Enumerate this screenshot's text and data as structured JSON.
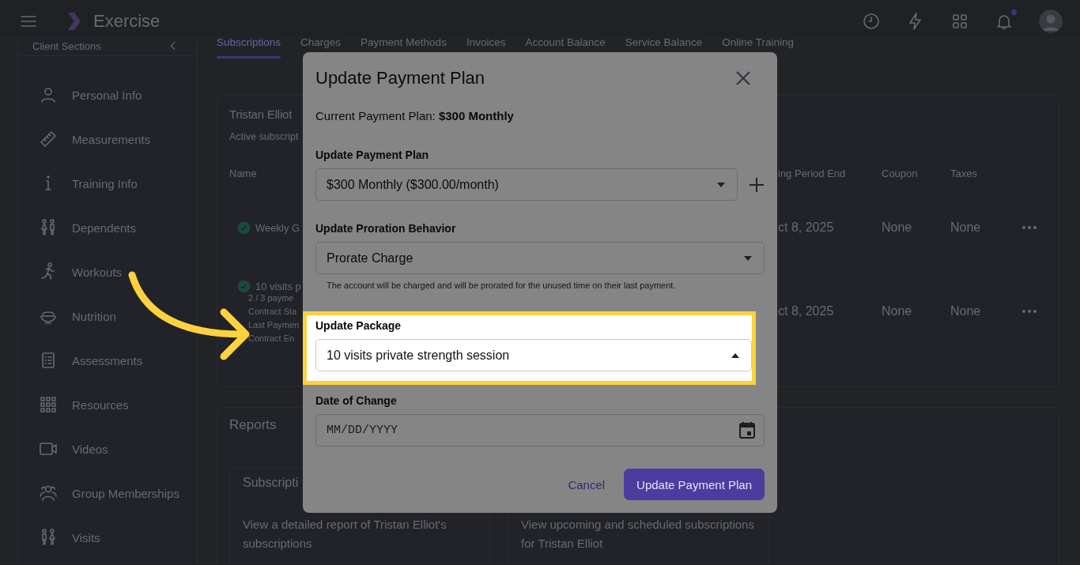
{
  "app_bar": {
    "title": "Exercise",
    "notification_dot": true
  },
  "sidebar": {
    "heading": "Client Sections",
    "items": [
      {
        "label": "Personal Info"
      },
      {
        "label": "Measurements"
      },
      {
        "label": "Training Info"
      },
      {
        "label": "Dependents"
      },
      {
        "label": "Workouts"
      },
      {
        "label": "Nutrition"
      },
      {
        "label": "Assessments"
      },
      {
        "label": "Resources"
      },
      {
        "label": "Videos"
      },
      {
        "label": "Group Memberships"
      },
      {
        "label": "Visits"
      }
    ]
  },
  "tabs": [
    {
      "label": "Subscriptions",
      "selected": true
    },
    {
      "label": "Charges",
      "selected": false
    },
    {
      "label": "Payment Methods",
      "selected": false
    },
    {
      "label": "Invoices",
      "selected": false
    },
    {
      "label": "Account Balance",
      "selected": false
    },
    {
      "label": "Service Balance",
      "selected": false
    },
    {
      "label": "Online Training",
      "selected": false
    }
  ],
  "subscriptions_card": {
    "title": "Tristan Elliot",
    "subtitle": "Active subscript",
    "columns": [
      "Name",
      "ing Period End",
      "Coupon",
      "Taxes"
    ],
    "rows": [
      {
        "name": "Weekly G",
        "details": [],
        "period_end": "ct 8, 2025",
        "coupon": "None",
        "taxes": "None"
      },
      {
        "name": "10 visits p",
        "details": [
          "2 / 3 payme",
          "Contract Sta",
          "Last Paymen",
          "Contract En"
        ],
        "period_end": "ct 8, 2025",
        "coupon": "None",
        "taxes": "None"
      }
    ]
  },
  "reports": {
    "title": "Reports",
    "cards": [
      {
        "title": "Subscripti",
        "description": "View a detailed report of Tristan Elliot's subscriptions"
      },
      {
        "description": "View upcoming and scheduled subscriptions for Tristan Elliot"
      }
    ]
  },
  "dialog": {
    "title": "Update Payment Plan",
    "current_plan": "Current Payment Plan: **$300 Monthly**",
    "fields": [
      {
        "kind": "select",
        "label": "Update Payment Plan",
        "value": "$300 Monthly ($300.00/month)",
        "expanded": false,
        "highlighted": false,
        "add": true
      },
      {
        "kind": "select",
        "label": "Update Proration Behavior",
        "value": "Prorate Charge",
        "expanded": false,
        "highlighted": false,
        "helper": "The account will be charged and will be prorated for the unused time on their last payment."
      },
      {
        "kind": "select",
        "label": "Update Package",
        "value": "10 visits private strength session",
        "expanded": true,
        "highlighted": true
      },
      {
        "kind": "date",
        "label": "Date of Change",
        "placeholder": "MM/DD/YYYY",
        "highlighted": false
      }
    ],
    "buttons": [
      {
        "label": "Cancel",
        "kind": "text"
      },
      {
        "label": "Update Payment Plan",
        "kind": "primary"
      }
    ]
  }
}
